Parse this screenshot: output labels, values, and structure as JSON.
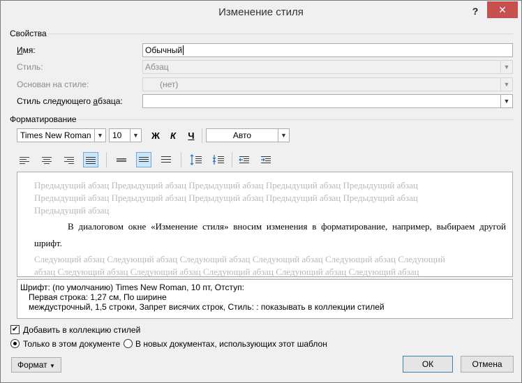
{
  "window": {
    "title": "Изменение стиля",
    "help": "?",
    "close": "✕"
  },
  "properties": {
    "group_label": "Свойства",
    "name_label": "Имя:",
    "name_value": "Обычный",
    "style_label": "Стиль:",
    "style_value": "Абзац",
    "based_on_label": "Основан на стиле:",
    "based_on_value": "(нет)",
    "next_style_label": "Стиль следующего абзаца:",
    "next_style_value": ""
  },
  "formatting": {
    "group_label": "Форматирование",
    "font": "Times New Roman",
    "size": "10",
    "bold": "Ж",
    "italic": "К",
    "underline": "Ч",
    "color": "Авто"
  },
  "preview": {
    "prev_line1": "Предыдущий абзац Предыдущий абзац Предыдущий абзац Предыдущий абзац Предыдущий абзац",
    "prev_line2": "Предыдущий абзац Предыдущий абзац Предыдущий абзац Предыдущий абзац Предыдущий абзац",
    "prev_line3": "Предыдущий абзац",
    "main_text": "В диалоговом окне «Изменение стиля» вносим изменения в форматирование, например, выбираем другой шрифт.",
    "next_line1": "Следующий абзац Следующий абзац Следующий абзац Следующий абзац Следующий абзац Следующий",
    "next_line2": "абзац Следующий абзац Следующий абзац Следующий абзац Следующий абзац Следующий абзац"
  },
  "description": {
    "line1": "Шрифт: (по умолчанию) Times New Roman, 10 пт, Отступ:",
    "line2": "Первая строка:  1,27 см, По ширине",
    "line3": "междустрочный,  1,5 строки, Запрет висячих строк, Стиль: : показывать в коллекции стилей"
  },
  "options": {
    "add_to_gallery": "Добавить в коллекцию стилей",
    "add_to_gallery_checked": true,
    "only_this_doc": "Только в этом документе",
    "new_docs": "В новых документах, использующих этот шаблон",
    "selected": "only_this_doc"
  },
  "buttons": {
    "format": "Формат",
    "ok": "ОК",
    "cancel": "Отмена"
  }
}
